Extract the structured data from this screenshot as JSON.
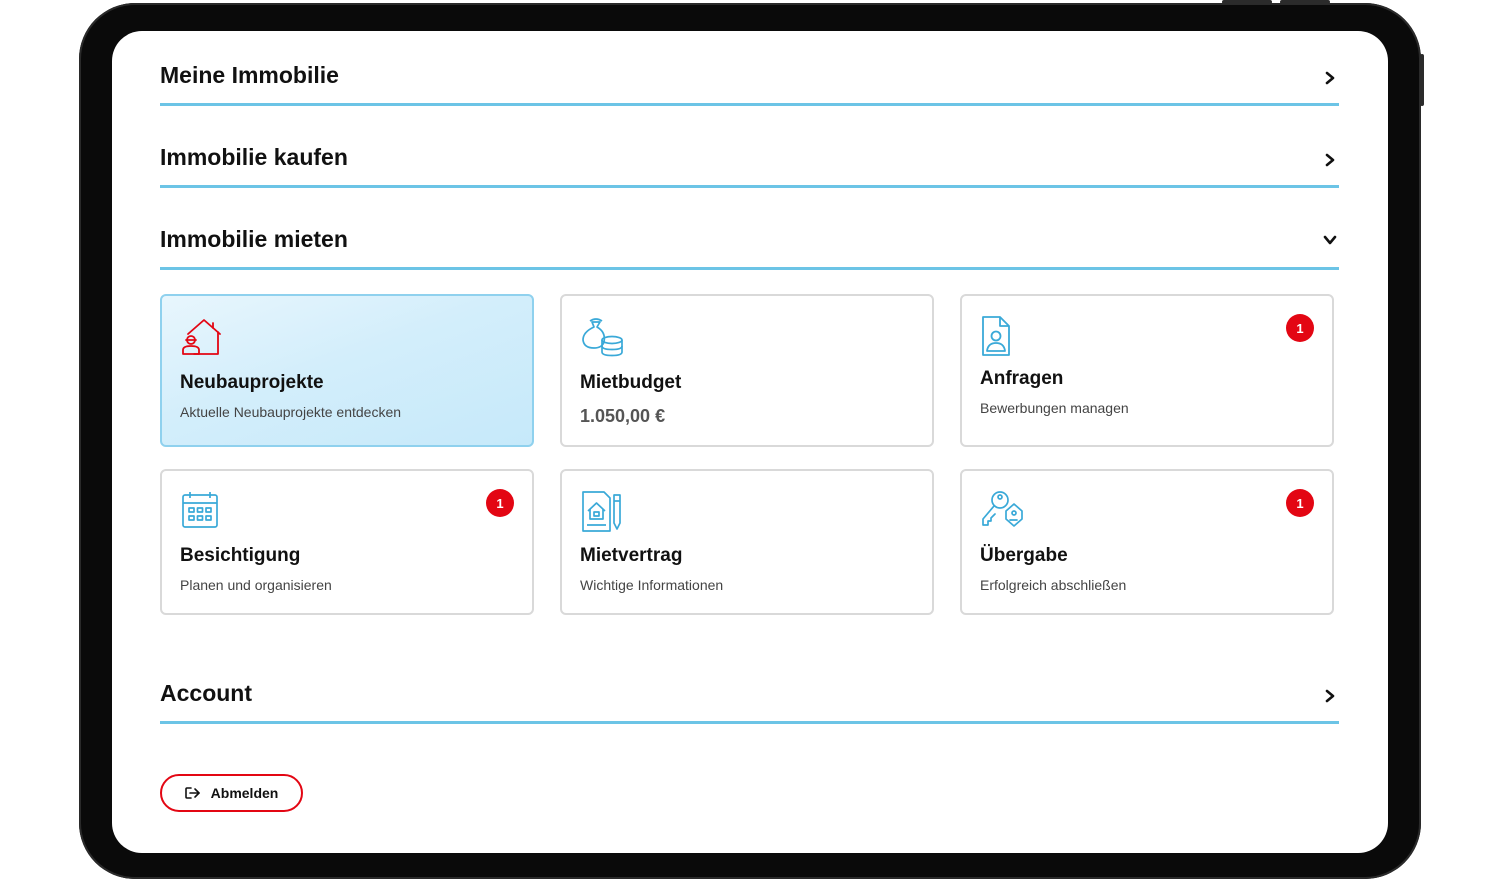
{
  "sections": {
    "meine_immobilie": "Meine Immobilie",
    "immobilie_kaufen": "Immobilie kaufen",
    "immobilie_mieten": "Immobilie mieten",
    "account": "Account"
  },
  "cards": {
    "neubau": {
      "title": "Neubauprojekte",
      "subtitle": "Aktuelle Neubauprojekte entdecken",
      "icon": "house-builder-icon"
    },
    "mietbudget": {
      "title": "Mietbudget",
      "value": "1.050,00 €",
      "icon": "money-coins-icon"
    },
    "anfragen": {
      "title": "Anfragen",
      "subtitle": "Bewerbungen managen",
      "badge": "1",
      "icon": "document-person-icon"
    },
    "besichtigung": {
      "title": "Besichtigung",
      "subtitle": "Planen und organisieren",
      "badge": "1",
      "icon": "calendar-icon"
    },
    "mietvertrag": {
      "title": "Mietvertrag",
      "subtitle": "Wichtige Informationen",
      "icon": "contract-pen-icon"
    },
    "uebergabe": {
      "title": "Übergabe",
      "subtitle": "Erfolgreich abschließen",
      "badge": "1",
      "icon": "keys-icon"
    }
  },
  "logout": {
    "label": "Abmelden",
    "icon": "logout-icon"
  },
  "colors": {
    "accent_red": "#e30613",
    "accent_blue": "#6cc4e6",
    "icon_blue": "#3aa9d8"
  }
}
